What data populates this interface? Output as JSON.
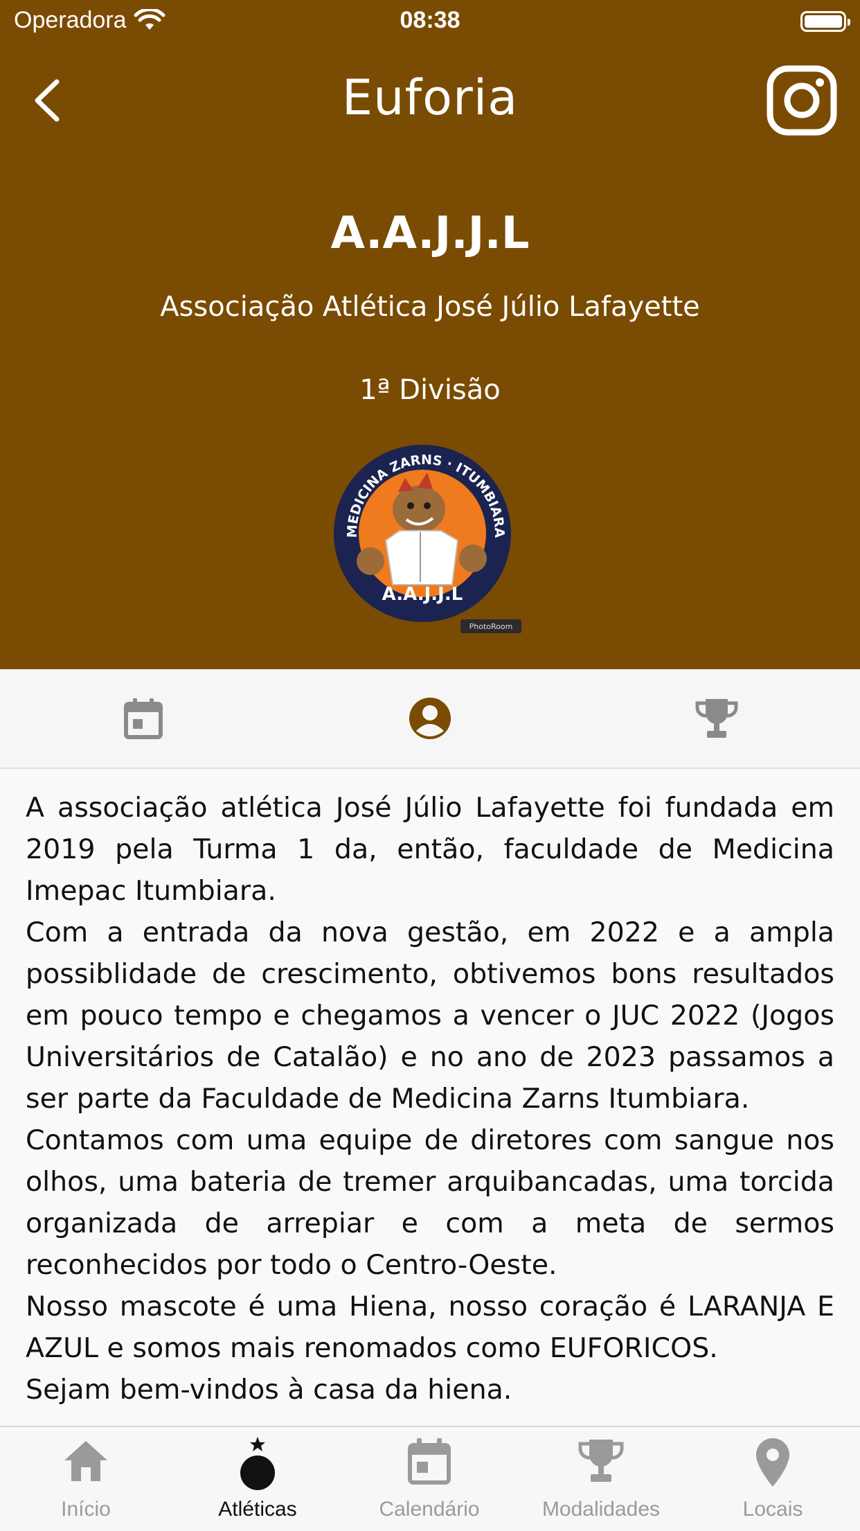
{
  "status_bar": {
    "carrier": "Operadora",
    "time": "08:38"
  },
  "nav": {
    "title": "Euforia",
    "back_icon": "chevron-left-icon",
    "right_icon": "instagram-icon"
  },
  "profile": {
    "abbreviation": "A.A.J.J.L",
    "full_name": "Associação Atlética José Júlio Lafayette",
    "division": "1ª Divisão",
    "logo": {
      "arc_text": "MEDICINA ZARNS · ITUMBIARA",
      "name_text": "A.A.J.J.L",
      "watermark": "PhotoRoom"
    }
  },
  "tabs": [
    {
      "icon": "calendar-icon",
      "active": false
    },
    {
      "icon": "account-circle-icon",
      "active": true
    },
    {
      "icon": "trophy-icon",
      "active": false
    }
  ],
  "description": [
    "A associação atlética José Júlio Lafayette foi fundada em 2019 pela Turma 1 da, então, faculdade de Medicina Imepac Itumbiara.",
    "Com a entrada da nova gestão, em 2022 e a ampla possiblidade de crescimento, obtivemos bons resultados em pouco tempo e chegamos a vencer o JUC 2022 (Jogos Universitários de Catalão) e no ano de 2023 passamos a ser parte da Faculdade de Medicina Zarns Itumbiara.",
    "Contamos com uma equipe de diretores com sangue nos olhos, uma bateria de tremer arquibancadas, uma torcida organizada de arrepiar e com a meta de sermos reconhecidos por todo o Centro-Oeste.",
    "Nosso mascote é uma Hiena, nosso coração é LARANJA E AZUL e somos mais renomados como EUFORICOS.",
    "Sejam bem-vindos à casa da hiena."
  ],
  "bottom_tabs": [
    {
      "label": "Início",
      "icon": "home-icon",
      "active": false
    },
    {
      "label": "Atléticas",
      "icon": "ball-star-icon",
      "active": true
    },
    {
      "label": "Calendário",
      "icon": "calendar-icon",
      "active": false
    },
    {
      "label": "Modalidades",
      "icon": "trophy-icon",
      "active": false
    },
    {
      "label": "Locais",
      "icon": "location-pin-icon",
      "active": false
    }
  ],
  "colors": {
    "header_bg": "#7a4b02",
    "accent": "#7a4b02",
    "inactive_icon": "#8a8a8a",
    "logo_orange": "#f07a1e",
    "logo_navy": "#1b2350"
  }
}
